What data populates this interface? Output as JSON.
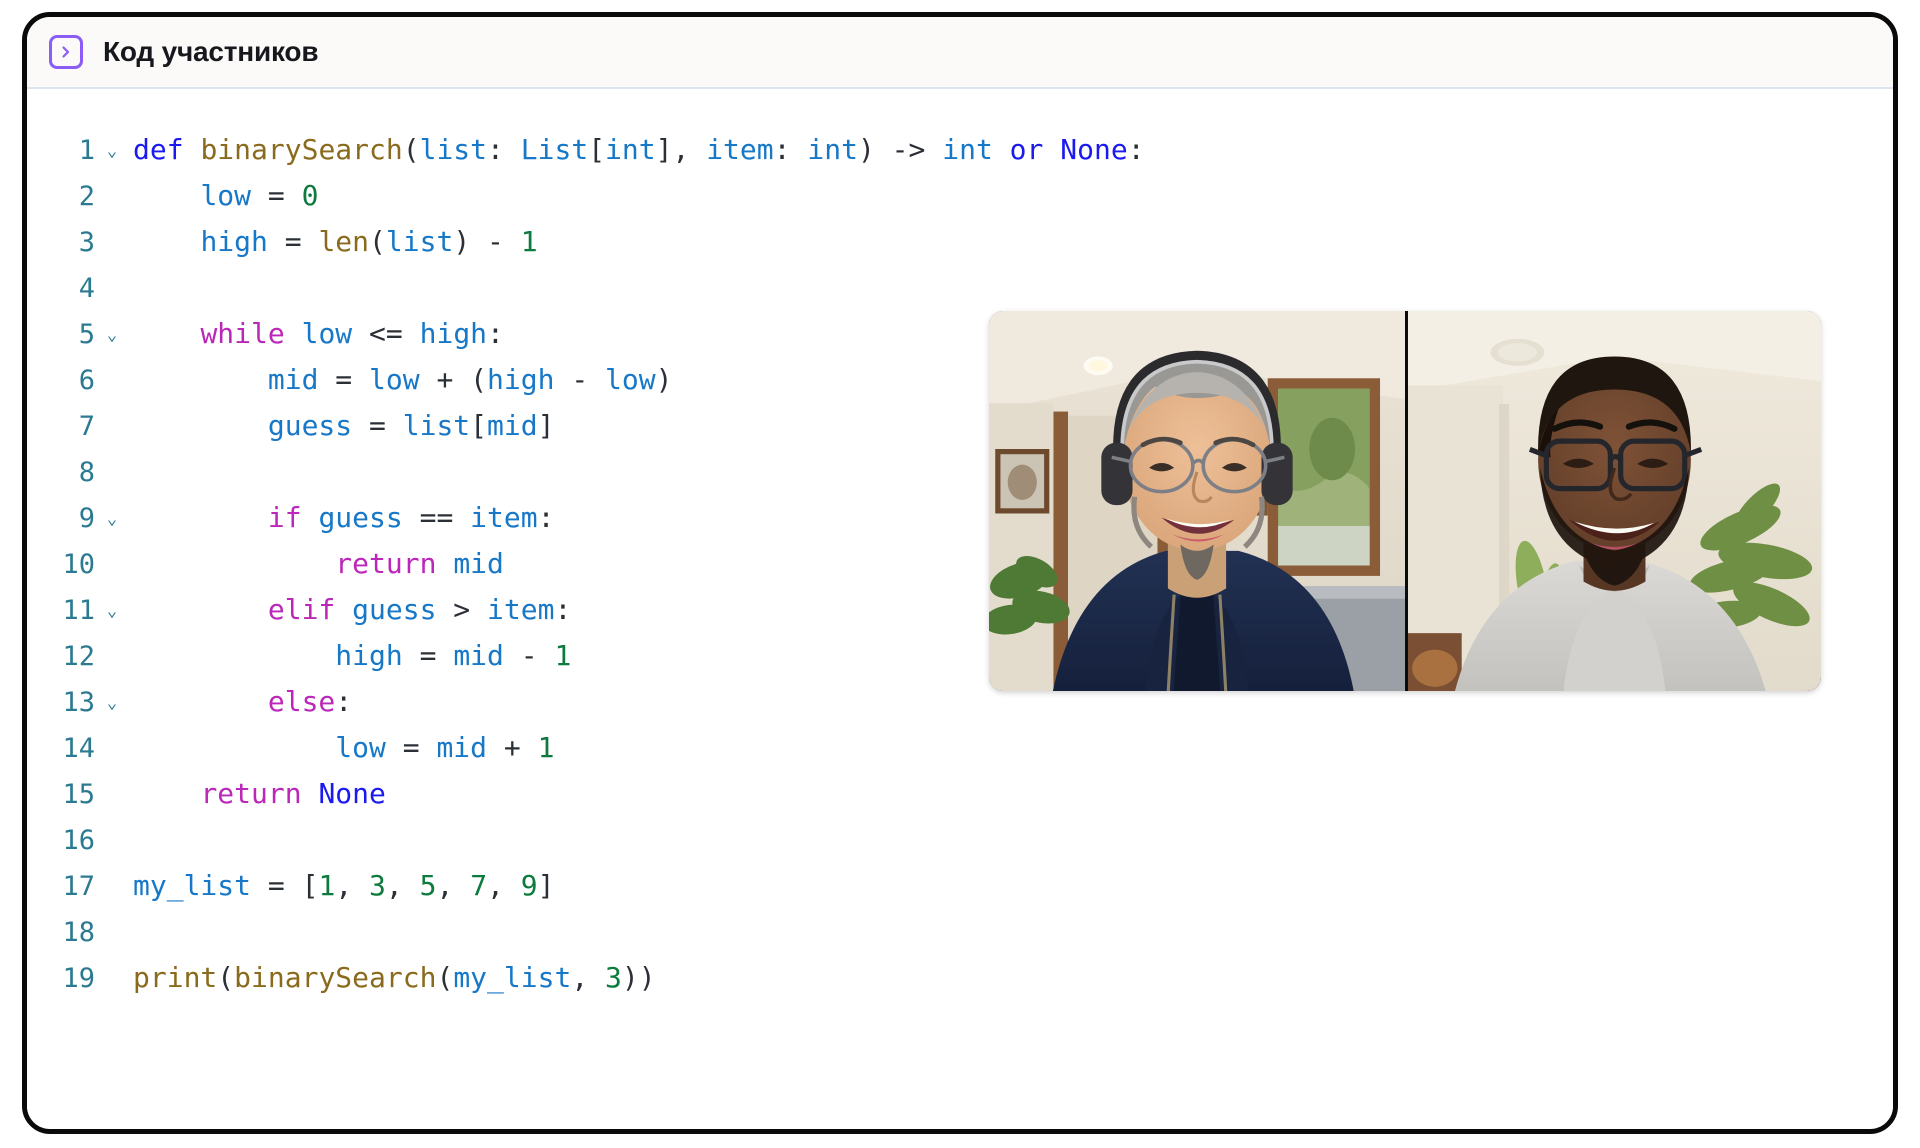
{
  "header": {
    "title": "Код участников",
    "icon": "code-chevron-icon",
    "icon_color": "#8b5cf6",
    "background": "#fbfaf8",
    "divider_color": "#dde3f0"
  },
  "theme": {
    "page_background": "#ffffff",
    "card_border": "#0a0a0a",
    "line_number_color": "#2b7a91",
    "keyword_blue": "#1a1aef",
    "keyword_magenta": "#bb27b8",
    "function_olive": "#8a6a1c",
    "variable_blue": "#1878c8",
    "number_green": "#0d7a3e",
    "punctuation": "#2b2f36"
  },
  "editor": {
    "language": "python",
    "total_lines": 19,
    "lines": [
      {
        "n": "1",
        "fold": "v",
        "raw": "def binarySearch(list: List[int], item: int) -> int or None:"
      },
      {
        "n": "2",
        "fold": "",
        "raw": "    low = 0"
      },
      {
        "n": "3",
        "fold": "",
        "raw": "    high = len(list) - 1"
      },
      {
        "n": "4",
        "fold": "",
        "raw": ""
      },
      {
        "n": "5",
        "fold": "v",
        "raw": "    while low <= high:"
      },
      {
        "n": "6",
        "fold": "",
        "raw": "        mid = low + (high - low)"
      },
      {
        "n": "7",
        "fold": "",
        "raw": "        guess = list[mid]"
      },
      {
        "n": "8",
        "fold": "",
        "raw": ""
      },
      {
        "n": "9",
        "fold": "v",
        "raw": "        if guess == item:"
      },
      {
        "n": "10",
        "fold": "",
        "raw": "            return mid"
      },
      {
        "n": "11",
        "fold": "v",
        "raw": "        elif guess > item:"
      },
      {
        "n": "12",
        "fold": "",
        "raw": "            high = mid - 1"
      },
      {
        "n": "13",
        "fold": "v",
        "raw": "        else:"
      },
      {
        "n": "14",
        "fold": "",
        "raw": "            low = mid + 1"
      },
      {
        "n": "15",
        "fold": "",
        "raw": "    return None"
      },
      {
        "n": "16",
        "fold": "",
        "raw": ""
      },
      {
        "n": "17",
        "fold": "",
        "raw": "my_list = [1, 3, 5, 7, 9]"
      },
      {
        "n": "18",
        "fold": "",
        "raw": ""
      },
      {
        "n": "19",
        "fold": "",
        "raw": "print(binarySearch(my_list, 3))"
      }
    ],
    "tokens": [
      [
        [
          "t-kw",
          "def"
        ],
        [
          "t-pun",
          " "
        ],
        [
          "t-fn",
          "binarySearch"
        ],
        [
          "t-pun",
          "("
        ],
        [
          "t-var",
          "list"
        ],
        [
          "t-pun",
          ": "
        ],
        [
          "t-var",
          "List"
        ],
        [
          "t-pun",
          "["
        ],
        [
          "t-var",
          "int"
        ],
        [
          "t-pun",
          "], "
        ],
        [
          "t-var",
          "item"
        ],
        [
          "t-pun",
          ": "
        ],
        [
          "t-var",
          "int"
        ],
        [
          "t-pun",
          ") -> "
        ],
        [
          "t-var",
          "int"
        ],
        [
          "t-pun",
          " "
        ],
        [
          "t-kw",
          "or"
        ],
        [
          "t-pun",
          " "
        ],
        [
          "t-kw",
          "None"
        ],
        [
          "t-pun",
          ":"
        ]
      ],
      [
        [
          "t-pun",
          "    "
        ],
        [
          "t-var",
          "low"
        ],
        [
          "t-pun",
          " = "
        ],
        [
          "t-num",
          "0"
        ]
      ],
      [
        [
          "t-pun",
          "    "
        ],
        [
          "t-var",
          "high"
        ],
        [
          "t-pun",
          " = "
        ],
        [
          "t-fn",
          "len"
        ],
        [
          "t-pun",
          "("
        ],
        [
          "t-var",
          "list"
        ],
        [
          "t-pun",
          ") - "
        ],
        [
          "t-num",
          "1"
        ]
      ],
      [],
      [
        [
          "t-pun",
          "    "
        ],
        [
          "t-kw2",
          "while"
        ],
        [
          "t-pun",
          " "
        ],
        [
          "t-var",
          "low"
        ],
        [
          "t-pun",
          " <= "
        ],
        [
          "t-var",
          "high"
        ],
        [
          "t-pun",
          ":"
        ]
      ],
      [
        [
          "t-pun",
          "        "
        ],
        [
          "t-var",
          "mid"
        ],
        [
          "t-pun",
          " = "
        ],
        [
          "t-var",
          "low"
        ],
        [
          "t-pun",
          " + ("
        ],
        [
          "t-var",
          "high"
        ],
        [
          "t-pun",
          " - "
        ],
        [
          "t-var",
          "low"
        ],
        [
          "t-pun",
          ")"
        ]
      ],
      [
        [
          "t-pun",
          "        "
        ],
        [
          "t-var",
          "guess"
        ],
        [
          "t-pun",
          " = "
        ],
        [
          "t-var",
          "list"
        ],
        [
          "t-pun",
          "["
        ],
        [
          "t-var",
          "mid"
        ],
        [
          "t-pun",
          "]"
        ]
      ],
      [],
      [
        [
          "t-pun",
          "        "
        ],
        [
          "t-kw2",
          "if"
        ],
        [
          "t-pun",
          " "
        ],
        [
          "t-var",
          "guess"
        ],
        [
          "t-pun",
          " == "
        ],
        [
          "t-var",
          "item"
        ],
        [
          "t-pun",
          ":"
        ]
      ],
      [
        [
          "t-pun",
          "            "
        ],
        [
          "t-kw2",
          "return"
        ],
        [
          "t-pun",
          " "
        ],
        [
          "t-var",
          "mid"
        ]
      ],
      [
        [
          "t-pun",
          "        "
        ],
        [
          "t-kw2",
          "elif"
        ],
        [
          "t-pun",
          " "
        ],
        [
          "t-var",
          "guess"
        ],
        [
          "t-pun",
          " > "
        ],
        [
          "t-var",
          "item"
        ],
        [
          "t-pun",
          ":"
        ]
      ],
      [
        [
          "t-pun",
          "            "
        ],
        [
          "t-var",
          "high"
        ],
        [
          "t-pun",
          " = "
        ],
        [
          "t-var",
          "mid"
        ],
        [
          "t-pun",
          " - "
        ],
        [
          "t-num",
          "1"
        ]
      ],
      [
        [
          "t-pun",
          "        "
        ],
        [
          "t-kw2",
          "else"
        ],
        [
          "t-pun",
          ":"
        ]
      ],
      [
        [
          "t-pun",
          "            "
        ],
        [
          "t-var",
          "low"
        ],
        [
          "t-pun",
          " = "
        ],
        [
          "t-var",
          "mid"
        ],
        [
          "t-pun",
          " + "
        ],
        [
          "t-num",
          "1"
        ]
      ],
      [
        [
          "t-pun",
          "    "
        ],
        [
          "t-kw2",
          "return"
        ],
        [
          "t-pun",
          " "
        ],
        [
          "t-kw",
          "None"
        ]
      ],
      [],
      [
        [
          "t-var",
          "my_list"
        ],
        [
          "t-pun",
          " = ["
        ],
        [
          "t-num",
          "1"
        ],
        [
          "t-pun",
          ", "
        ],
        [
          "t-num",
          "3"
        ],
        [
          "t-pun",
          ", "
        ],
        [
          "t-num",
          "5"
        ],
        [
          "t-pun",
          ", "
        ],
        [
          "t-num",
          "7"
        ],
        [
          "t-pun",
          ", "
        ],
        [
          "t-num",
          "9"
        ],
        [
          "t-pun",
          "]"
        ]
      ],
      [],
      [
        [
          "t-fn",
          "print"
        ],
        [
          "t-pun",
          "("
        ],
        [
          "t-fn",
          "binarySearch"
        ],
        [
          "t-pun",
          "("
        ],
        [
          "t-var",
          "my_list"
        ],
        [
          "t-pun",
          ", "
        ],
        [
          "t-num",
          "3"
        ],
        [
          "t-pun",
          "))"
        ]
      ]
    ]
  },
  "video": {
    "layout": "two-up-strip",
    "tiles": [
      {
        "name": "participant-video-left",
        "description": "Smiling man with gray hair wearing over-ear headphones, glasses and a navy blue hoodie, seated in a room with framed pictures, a mirror and a houseplant",
        "wall": "#e6dfd2",
        "ceiling": "#e9e4d9",
        "skin": "#e0b289",
        "hair": "#8f8d8a",
        "clothing": "#1d2a4a",
        "accent": "#6b4a2e"
      },
      {
        "name": "participant-video-right",
        "description": "Smiling man with short dark hair, beard and black-framed glasses wearing a light gray crew-neck sweater, plant and cream wall behind",
        "wall": "#eee8dc",
        "ceiling": "#efe9dd",
        "skin": "#6b4530",
        "hair": "#241a14",
        "clothing": "#cfcdc9",
        "accent": "#7f9a4a"
      }
    ]
  }
}
